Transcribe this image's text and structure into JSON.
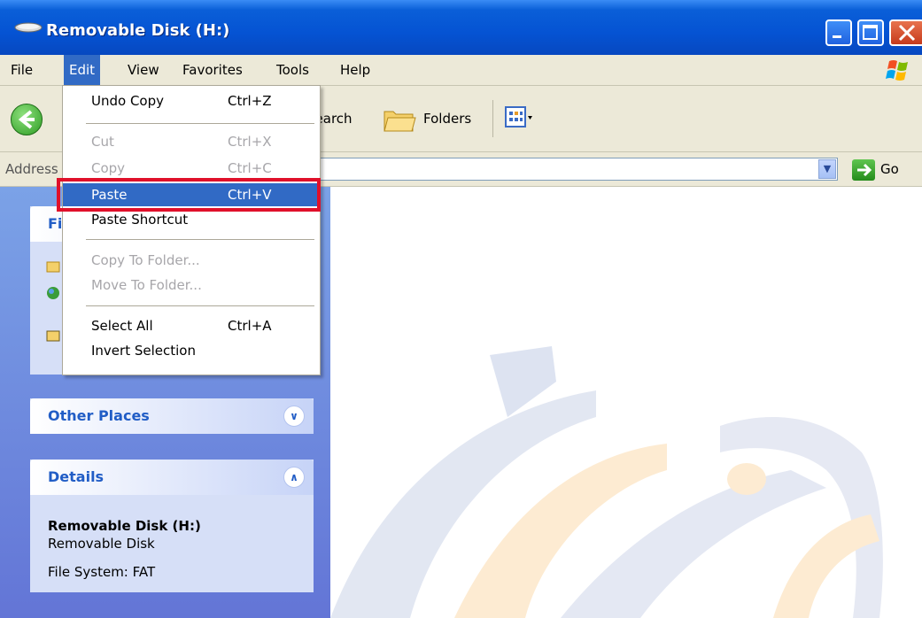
{
  "window": {
    "title": "Removable Disk (H:)",
    "icon": "drive-icon"
  },
  "menubar": {
    "items": [
      "File",
      "Edit",
      "View",
      "Favorites",
      "Tools",
      "Help"
    ],
    "active": "Edit"
  },
  "toolbar": {
    "search_label": "Search",
    "folders_label": "Folders"
  },
  "address": {
    "label": "Address",
    "go_label": "Go"
  },
  "edit_menu": {
    "items": [
      {
        "label": "Undo Copy",
        "accel": "Ctrl+Z",
        "enabled": true
      },
      {
        "label": "Cut",
        "accel": "Ctrl+X",
        "enabled": false
      },
      {
        "label": "Copy",
        "accel": "Ctrl+C",
        "enabled": false
      },
      {
        "label": "Paste",
        "accel": "Ctrl+V",
        "enabled": true,
        "selected": true
      },
      {
        "label": "Paste Shortcut",
        "accel": "",
        "enabled": true
      },
      {
        "label": "Copy To Folder...",
        "accel": "",
        "enabled": false
      },
      {
        "label": "Move To Folder...",
        "accel": "",
        "enabled": false
      },
      {
        "label": "Select All",
        "accel": "Ctrl+A",
        "enabled": true
      },
      {
        "label": "Invert Selection",
        "accel": "",
        "enabled": true
      }
    ],
    "highlight_color": "#e0102a"
  },
  "left_pane": {
    "first_panel_title": "Fi",
    "other_places": {
      "title": "Other Places",
      "state": "collapsed"
    },
    "details": {
      "title": "Details",
      "state": "expanded",
      "name": "Removable Disk (H:)",
      "type": "Removable Disk",
      "file_system": "File System: FAT"
    }
  },
  "colors": {
    "titlebar": "#0553d3",
    "menu_selected": "#316ac5",
    "panel_title": "#215dc6"
  }
}
